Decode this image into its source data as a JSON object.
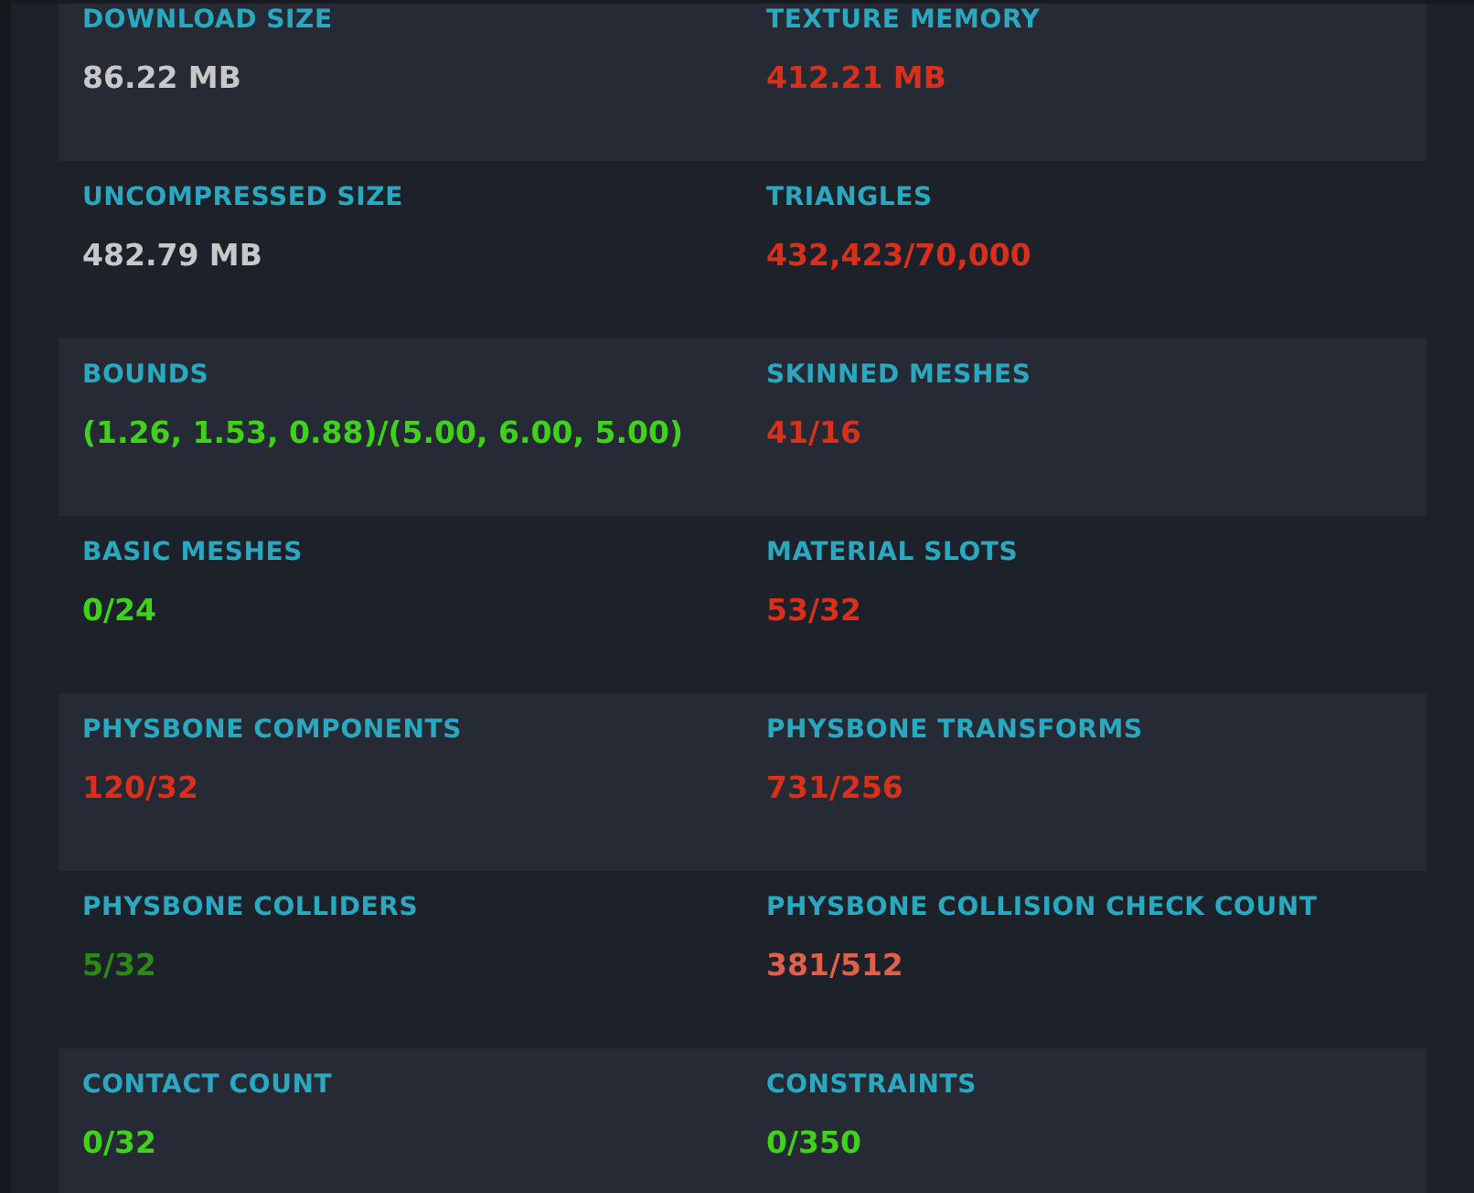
{
  "stats": [
    {
      "label": "DOWNLOAD SIZE",
      "value": "86.22 MB",
      "color": "#c8c8c8"
    },
    {
      "label": "TEXTURE MEMORY",
      "value": "412.21 MB",
      "color": "#d9301c"
    },
    {
      "label": "UNCOMPRESSED SIZE",
      "value": "482.79 MB",
      "color": "#c8c8c8"
    },
    {
      "label": "TRIANGLES",
      "value": "432,423/70,000",
      "color": "#d9301c"
    },
    {
      "label": "BOUNDS",
      "value": "(1.26, 1.53, 0.88)/(5.00, 6.00, 5.00)",
      "color": "#3ed21a"
    },
    {
      "label": "SKINNED MESHES",
      "value": "41/16",
      "color": "#d9301c"
    },
    {
      "label": "BASIC MESHES",
      "value": "0/24",
      "color": "#3ed21a"
    },
    {
      "label": "MATERIAL SLOTS",
      "value": "53/32",
      "color": "#d9301c"
    },
    {
      "label": "PHYSBONE COMPONENTS",
      "value": "120/32",
      "color": "#d9301c"
    },
    {
      "label": "PHYSBONE TRANSFORMS",
      "value": "731/256",
      "color": "#d9301c"
    },
    {
      "label": "PHYSBONE COLLIDERS",
      "value": "5/32",
      "color": "#2a8a14"
    },
    {
      "label": "PHYSBONE COLLISION CHECK COUNT",
      "value": "381/512",
      "color": "#e0604a"
    },
    {
      "label": "CONTACT COUNT",
      "value": "0/32",
      "color": "#3ed21a"
    },
    {
      "label": "CONSTRAINTS",
      "value": "0/350",
      "color": "#3ed21a"
    }
  ]
}
